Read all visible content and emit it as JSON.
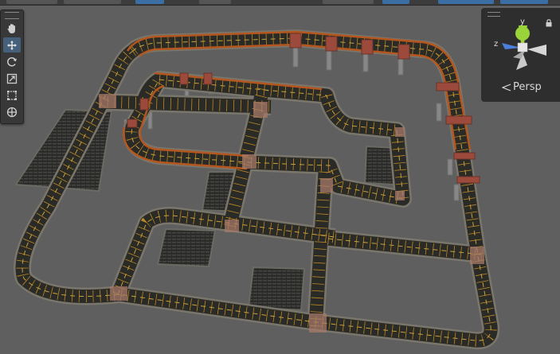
{
  "toolbar": {
    "tools": [
      {
        "name": "hand-tool",
        "active": false
      },
      {
        "name": "move-tool",
        "active": true
      },
      {
        "name": "rotate-tool",
        "active": false
      },
      {
        "name": "scale-tool",
        "active": false
      },
      {
        "name": "rect-tool",
        "active": false
      },
      {
        "name": "transform-tool",
        "active": false
      }
    ]
  },
  "gizmo": {
    "projection_label": "Persp",
    "axis_y": "y",
    "axis_z": "z",
    "axis_x": "x"
  },
  "colors": {
    "background": "#5f5f5f",
    "road": "#2a2a27",
    "road_edge": "#7a766c",
    "lane_marking": "#d79a25",
    "bridge_rail": "#b4561e",
    "support_block": "#9b4a3c",
    "pillar": "#8a8a8a",
    "gizmo_y": "#9bd43a",
    "gizmo_z": "#4a7fdc"
  }
}
